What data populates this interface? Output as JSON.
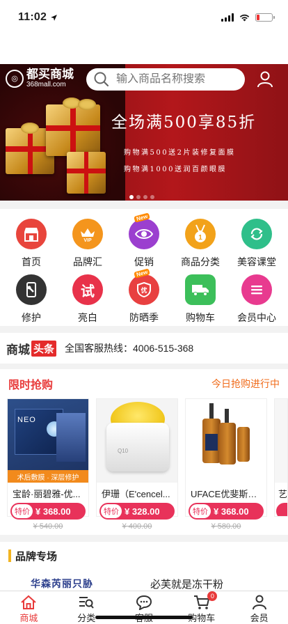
{
  "status_bar": {
    "time": "11:02"
  },
  "banner": {
    "logo_cn": "都买商城",
    "logo_en": "368mall.com",
    "search_placeholder": "输入商品名称搜索",
    "headline": "全场满500享85折",
    "line1": "购物满500送2片装修复面膜",
    "line2": "购物满1000送润百颜眼膜"
  },
  "nav": [
    {
      "label": "首页",
      "icon": "shop-icon",
      "color": "#e8453c"
    },
    {
      "label": "品牌汇",
      "icon": "vip-crown-icon",
      "color": "#f4951d"
    },
    {
      "label": "促销",
      "icon": "eye-icon",
      "color": "#9b3fcf"
    },
    {
      "label": "商品分类",
      "icon": "medal-icon",
      "color": "#f2a21a"
    },
    {
      "label": "美容课堂",
      "icon": "refresh-icon",
      "color": "#2fbf8a"
    },
    {
      "label": "修护",
      "icon": "wrench-phone-icon",
      "color": "#333333"
    },
    {
      "label": "亮白",
      "icon": "try-icon",
      "color": "#e8324a"
    },
    {
      "label": "防晒季",
      "icon": "shield-icon",
      "color": "#e84040"
    },
    {
      "label": "购物车",
      "icon": "truck-icon",
      "color": "#3cbf5a"
    },
    {
      "label": "会员中心",
      "icon": "list-icon",
      "color": "#e83a8f"
    }
  ],
  "notice": {
    "brand": "商城",
    "tag": "头条",
    "text": "全国客服热线：4006-515-368"
  },
  "flash_sale": {
    "title": "限时抢购",
    "more": "今日抢购进行中",
    "tag": "特价",
    "products": [
      {
        "name": "宝龄·丽碧雅-优...",
        "price": "¥ 368.00",
        "old_price": "¥ 540.00",
        "img_caption": "术后敷膜 · 深层修护"
      },
      {
        "name": "伊珊（E'cencel...",
        "price": "¥ 328.00",
        "old_price": "¥ 400.00"
      },
      {
        "name": "UFACE优斐斯烟...",
        "price": "¥ 368.00",
        "old_price": "¥ 580.00"
      },
      {
        "name": "艺",
        "price": "",
        "old_price": ""
      }
    ]
  },
  "brand_zone": {
    "title": "品牌专场",
    "sub1": "华森芮丽只胁",
    "sub2": "必芙就是冻干粉"
  },
  "tabbar": [
    {
      "label": "商城",
      "icon": "home-icon",
      "active": true
    },
    {
      "label": "分类",
      "icon": "category-icon",
      "active": false
    },
    {
      "label": "客服",
      "icon": "chat-icon",
      "active": false
    },
    {
      "label": "购物车",
      "icon": "cart-icon",
      "active": false,
      "badge": "0"
    },
    {
      "label": "会员",
      "icon": "user-icon",
      "active": false
    }
  ]
}
